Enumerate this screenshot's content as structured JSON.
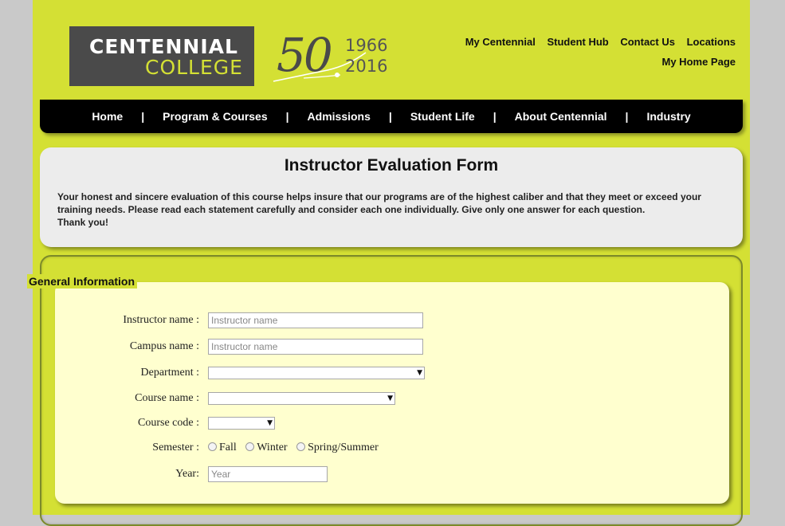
{
  "header": {
    "logo_line1": "CENTENNIAL",
    "logo_line2": "COLLEGE",
    "anniversary_number": "50",
    "anniversary_start": "1966",
    "anniversary_end": "2016",
    "top_links": [
      "My Centennial",
      "Student Hub",
      "Contact Us",
      "Locations"
    ],
    "home_page_link": "My Home Page"
  },
  "nav": {
    "items": [
      "Home",
      "Program & Courses",
      "Admissions",
      "Student Life",
      "About Centennial",
      "Industry"
    ],
    "separator": "|"
  },
  "intro": {
    "title": "Instructor Evaluation Form",
    "description": "Your honest and sincere evaluation of this course helps insure that our programs are of the highest caliber and that they meet or exceed your training needs. Please read each statement carefully and consider each one individually. Give only one answer for each question.",
    "thanks": "Thank you!"
  },
  "form": {
    "legend": "General Information",
    "instructor_label": "Instructor name :",
    "instructor_placeholder": "Instructor name",
    "campus_label": "Campus name :",
    "campus_placeholder": "Instructor name",
    "department_label": "Department :",
    "department_value": "",
    "course_name_label": "Course name :",
    "course_name_value": "",
    "course_code_label": "Course code :",
    "course_code_value": "",
    "semester_label": "Semester :",
    "semester_options": [
      "Fall",
      "Winter",
      "Spring/Summer"
    ],
    "year_label": "Year:",
    "year_placeholder": "Year"
  },
  "colors": {
    "page_bg": "#d4e034",
    "outer_bg": "#c9c9c9",
    "nav_bg": "#000000",
    "panel_bg": "#ececec",
    "fieldset_bg": "#ffffcf"
  }
}
